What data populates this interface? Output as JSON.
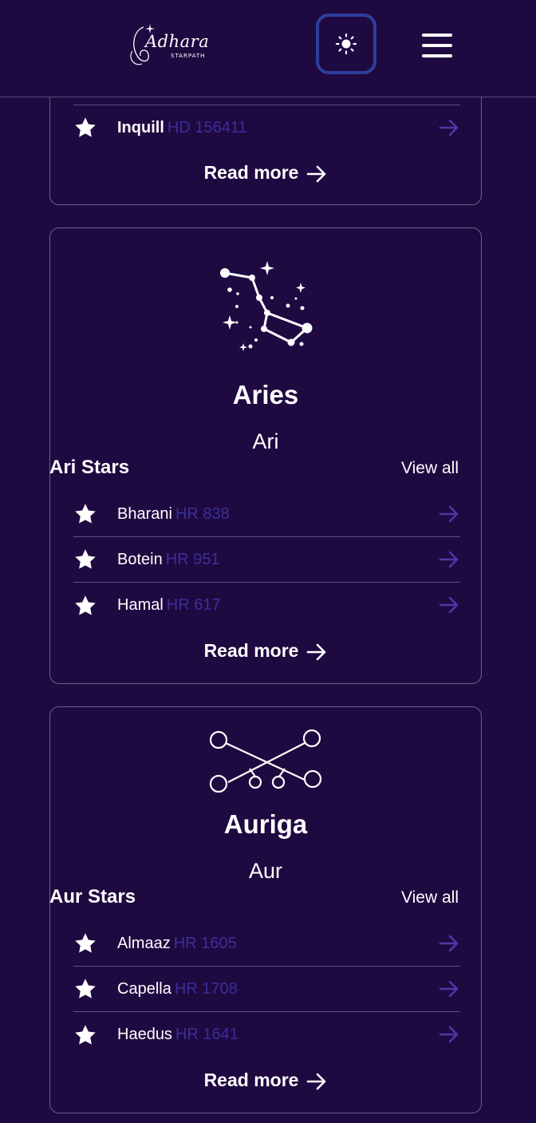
{
  "header": {
    "logo_text": "Adhara",
    "logo_sub": "STARPATH",
    "theme_icon": "sun-icon",
    "menu_icon": "hamburger-menu-icon"
  },
  "colors": {
    "background": "#1f0941",
    "accent_border": "#2d3f9c",
    "star_code": "#3a2f9a",
    "arrow": "#4a3aa8"
  },
  "cards": [
    {
      "stars": [
        {
          "name": "Inquill",
          "code": "HD 156411"
        }
      ],
      "read_more": "Read more"
    },
    {
      "name": "Aries",
      "abbr": "Ari",
      "stars_title": "Ari Stars",
      "view_all": "View all",
      "stars": [
        {
          "name": "Bharani",
          "code": "HR 838"
        },
        {
          "name": "Botein",
          "code": "HR 951"
        },
        {
          "name": "Hamal",
          "code": "HR 617"
        }
      ],
      "read_more": "Read more"
    },
    {
      "name": "Auriga",
      "abbr": "Aur",
      "stars_title": "Aur Stars",
      "view_all": "View all",
      "stars": [
        {
          "name": "Almaaz",
          "code": "HR 1605"
        },
        {
          "name": "Capella",
          "code": "HR 1708"
        },
        {
          "name": "Haedus",
          "code": "HR 1641"
        }
      ],
      "read_more": "Read more"
    }
  ]
}
